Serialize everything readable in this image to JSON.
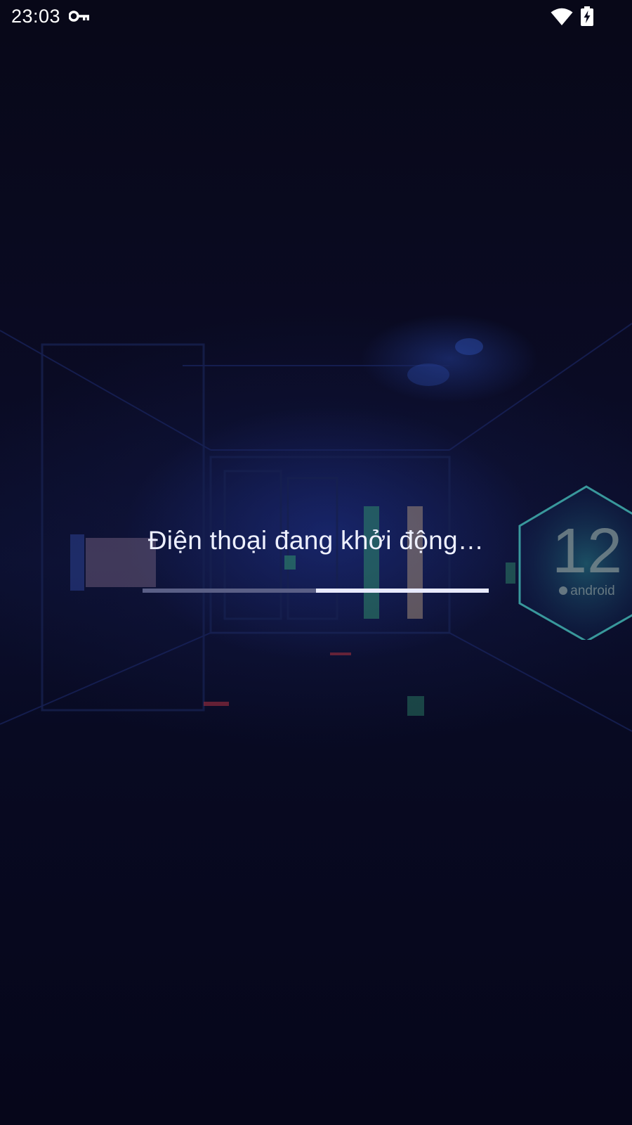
{
  "status_bar": {
    "time": "23:03",
    "icons": [
      "key-icon",
      "wifi-icon",
      "battery-charging-icon"
    ]
  },
  "boot": {
    "message": "Điện thoại đang khởi động…",
    "progress": {
      "indeterminate": true,
      "indicator_start": 0.5,
      "indicator_end": 1.0
    }
  },
  "wallpaper": {
    "badge_number": "12",
    "badge_label": "android"
  },
  "colors": {
    "background": "#07071c",
    "text": "#eef0ff",
    "progress_track": "#5a5f86",
    "progress_indicator": "#e8eaff",
    "badge_fill": "#1f6b7a"
  }
}
